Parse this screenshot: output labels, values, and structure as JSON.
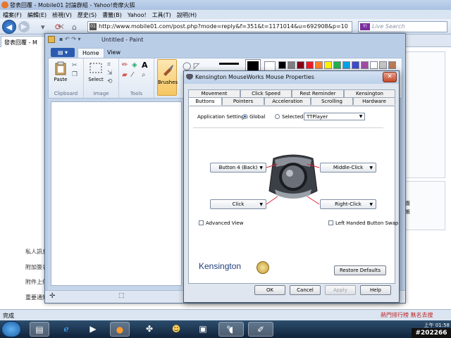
{
  "browser": {
    "title": "發表回覆 - Mobile01 討論群組 - Yahoo!奇摩火狐",
    "menu": [
      "檔案(F)",
      "編輯(E)",
      "檢視(V)",
      "歷史(S)",
      "書籤(B)",
      "Yahoo!",
      "工具(T)",
      "說明(H)"
    ],
    "url": "http://www.mobile01.com/post.php?mode=reply&f=351&t=1171014&u=692908&p=10",
    "search_placeholder": "Live Search",
    "tab_label": "發表回覆 - M",
    "page_labels": [
      "私人訊息",
      "附加簽名",
      "附件上傳",
      "重要通知"
    ],
    "right_box_texts": [
      "復",
      "帳"
    ],
    "status": "完成",
    "status_right": "熱門排行榜    無名去搜"
  },
  "taskbar": {
    "clock_time": "上午 01:58",
    "watermark": "#202266"
  },
  "paint": {
    "title": "Untitled - Paint",
    "tabs": [
      "Home",
      "View"
    ],
    "groups": {
      "clipboard": "Clipboard",
      "image": "Image",
      "tools": "Tools"
    },
    "buttons": {
      "paste": "Paste",
      "select": "Select",
      "brushes": "Brushes"
    },
    "palette": [
      "#000000",
      "#7f7f7f",
      "#880015",
      "#ed1c24",
      "#ff7f27",
      "#fff200",
      "#22b14c",
      "#00a2e8",
      "#3f48cc",
      "#a349a4",
      "#ffffff",
      "#c3c3c3",
      "#b97a57"
    ]
  },
  "dialog": {
    "title": "Kensington MouseWorks Mouse Properties",
    "tabs_row1": [
      "Movement",
      "Click Speed",
      "Rest Reminder",
      "Kensington"
    ],
    "tabs_row2": [
      "Buttons",
      "Pointers",
      "Acceleration",
      "Scrolling",
      "Hardware"
    ],
    "app_settings_label": "Application Settings:",
    "global_label": "Global",
    "selected_label": "Selected:",
    "selected_app": "TTPlayer",
    "button_assignments": {
      "top_left": "Button 4 (Back)",
      "top_right": "Middle-Click",
      "bottom_left": "Click",
      "bottom_right": "Right-Click"
    },
    "advanced_view": "Advanced View",
    "left_handed": "Left Handed Button Swap",
    "logo": "Kensington",
    "restore_defaults": "Restore Defaults",
    "ok": "OK",
    "cancel": "Cancel",
    "apply": "Apply",
    "help": "Help"
  }
}
